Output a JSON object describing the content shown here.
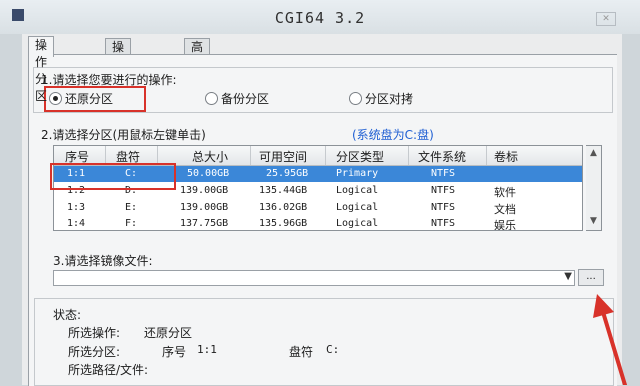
{
  "window": {
    "title": "CGI64 3.2"
  },
  "tabs": [
    "操作分区",
    "操作硬盘",
    "高 级"
  ],
  "step1": {
    "label": "1.请选择您要进行的操作:",
    "options": [
      "还原分区",
      "备份分区",
      "分区对拷"
    ],
    "selected": "还原分区"
  },
  "step2": {
    "label": "2.请选择分区(用鼠标左键单击)",
    "system_note": "(系统盘为C:盘)"
  },
  "table": {
    "columns": [
      "序号",
      "盘符",
      "总大小",
      "可用空间",
      "分区类型",
      "文件系统",
      "卷标"
    ],
    "rows": [
      {
        "no": "1:1",
        "drive": "C:",
        "total": "50.00GB",
        "free": "25.95GB",
        "type": "Primary",
        "fs": "NTFS",
        "label": ""
      },
      {
        "no": "1:2",
        "drive": "D:",
        "total": "139.00GB",
        "free": "135.44GB",
        "type": "Logical",
        "fs": "NTFS",
        "label": "软件"
      },
      {
        "no": "1:3",
        "drive": "E:",
        "total": "139.00GB",
        "free": "136.02GB",
        "type": "Logical",
        "fs": "NTFS",
        "label": "文档"
      },
      {
        "no": "1:4",
        "drive": "F:",
        "total": "137.75GB",
        "free": "135.96GB",
        "type": "Logical",
        "fs": "NTFS",
        "label": "娱乐"
      }
    ],
    "selected_row": 0
  },
  "step3": {
    "label": "3.请选择镜像文件:",
    "value": "",
    "browse_label": "..."
  },
  "status": {
    "heading": "状态:",
    "op_label": "所选操作:",
    "op_value": "还原分区",
    "part_label": "所选分区:",
    "part_no_label": "序号",
    "part_no": "1:1",
    "drive_label": "盘符",
    "drive_value": "C:",
    "path_label": "所选路径/文件:"
  },
  "colors": {
    "accent_blue": "#1f5fd3",
    "selection": "#3b87d8",
    "annotation_red": "#d8322a"
  }
}
